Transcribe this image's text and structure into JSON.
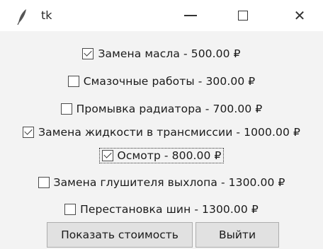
{
  "window": {
    "title": "tk"
  },
  "options": [
    {
      "label": "Замена масла - 500.00 ₽",
      "checked": true
    },
    {
      "label": "Смазочные работы - 300.00 ₽",
      "checked": false
    },
    {
      "label": "Промывка радиатора - 700.00 ₽",
      "checked": false
    },
    {
      "label": "Замена жидкости в трансмиссии - 1000.00 ₽",
      "checked": true
    },
    {
      "label": "Осмотр - 800.00 ₽",
      "checked": true
    },
    {
      "label": "Замена глушителя выхлопа - 1300.00 ₽",
      "checked": false
    },
    {
      "label": "Перестановка шин - 1300.00 ₽",
      "checked": false
    }
  ],
  "buttons": {
    "show_cost": "Показать стоимость",
    "exit": "Выйти"
  }
}
